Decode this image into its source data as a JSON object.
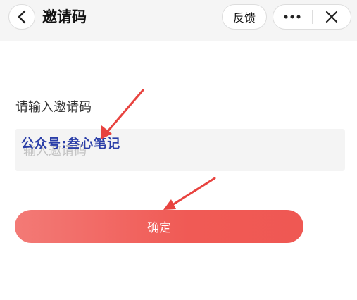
{
  "header": {
    "title": "邀请码",
    "feedback_label": "反馈",
    "back_icon": "chevron-left-icon",
    "more_icon": "more-dots-icon",
    "close_icon": "close-icon"
  },
  "form": {
    "label": "请输入邀请码",
    "input_placeholder": "输入邀请码",
    "input_value": "",
    "confirm_label": "确定"
  },
  "overlay": {
    "watermark_text": "公众号:叁心笔记",
    "arrow_color": "#e8433f"
  },
  "colors": {
    "accent": "#f05a55",
    "background": "#f5f5f5"
  }
}
